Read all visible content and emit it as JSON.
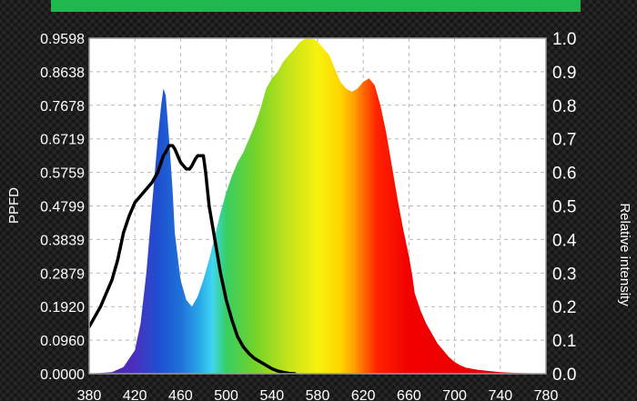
{
  "chart_data": {
    "type": "area",
    "title": "",
    "xlabel": "",
    "ylabel": "PPFD",
    "y2label": "Relative intensity",
    "xlim": [
      380,
      780
    ],
    "ylim": [
      0,
      0.9598
    ],
    "y2lim": [
      0,
      1.0
    ],
    "grid": true,
    "x_ticks": [
      "380",
      "420",
      "460",
      "500",
      "540",
      "580",
      "620",
      "660",
      "700",
      "740",
      "780"
    ],
    "y_ticks": [
      "0.0000",
      "0.0960",
      "0.1920",
      "0.2879",
      "0.3839",
      "0.4799",
      "0.5759",
      "0.6719",
      "0.7678",
      "0.8638",
      "0.9598"
    ],
    "y2_ticks": [
      "0.0",
      "0.1",
      "0.2",
      "0.3",
      "0.4",
      "0.5",
      "0.6",
      "0.7",
      "0.8",
      "0.9",
      "1.0"
    ],
    "series": [
      {
        "axis": "right",
        "style": "spectrum-filled",
        "x": [
          380,
          400,
          410,
          420,
          425,
          430,
          435,
          440,
          443,
          445,
          447,
          450,
          453,
          455,
          460,
          465,
          470,
          475,
          480,
          485,
          490,
          495,
          500,
          505,
          510,
          515,
          520,
          525,
          530,
          535,
          540,
          545,
          550,
          555,
          560,
          565,
          570,
          575,
          580,
          585,
          590,
          595,
          600,
          605,
          610,
          615,
          620,
          625,
          630,
          635,
          640,
          645,
          650,
          655,
          660,
          663,
          665,
          670,
          675,
          680,
          685,
          690,
          695,
          700,
          705,
          710,
          720,
          730,
          740,
          750,
          760,
          770,
          780
        ],
        "values": [
          0.0,
          0.005,
          0.02,
          0.07,
          0.15,
          0.3,
          0.5,
          0.7,
          0.8,
          0.85,
          0.83,
          0.7,
          0.55,
          0.42,
          0.28,
          0.22,
          0.2,
          0.23,
          0.28,
          0.34,
          0.41,
          0.48,
          0.54,
          0.59,
          0.63,
          0.66,
          0.7,
          0.74,
          0.79,
          0.85,
          0.88,
          0.9,
          0.93,
          0.95,
          0.97,
          0.99,
          1.0,
          1.0,
          0.99,
          0.97,
          0.95,
          0.91,
          0.87,
          0.85,
          0.84,
          0.85,
          0.87,
          0.88,
          0.86,
          0.8,
          0.72,
          0.62,
          0.52,
          0.43,
          0.35,
          0.29,
          0.24,
          0.19,
          0.15,
          0.12,
          0.09,
          0.07,
          0.05,
          0.035,
          0.025,
          0.018,
          0.012,
          0.008,
          0.005,
          0.003,
          0.002,
          0.001,
          0.0
        ]
      },
      {
        "axis": "right",
        "style": "line",
        "color": "#000000",
        "x": [
          380,
          390,
          400,
          405,
          410,
          415,
          420,
          425,
          430,
          435,
          440,
          443,
          445,
          447,
          450,
          453,
          455,
          460,
          465,
          468,
          470,
          473,
          475,
          480,
          482,
          485,
          490,
          495,
          500,
          505,
          510,
          515,
          520,
          525,
          530,
          535,
          540,
          545,
          550,
          555,
          560
        ],
        "values": [
          0.14,
          0.2,
          0.28,
          0.34,
          0.42,
          0.47,
          0.51,
          0.53,
          0.55,
          0.57,
          0.6,
          0.63,
          0.65,
          0.66,
          0.68,
          0.68,
          0.67,
          0.63,
          0.61,
          0.61,
          0.62,
          0.64,
          0.65,
          0.65,
          0.6,
          0.5,
          0.4,
          0.3,
          0.22,
          0.16,
          0.11,
          0.08,
          0.06,
          0.045,
          0.035,
          0.025,
          0.015,
          0.008,
          0.004,
          0.001,
          0.0
        ]
      }
    ]
  }
}
